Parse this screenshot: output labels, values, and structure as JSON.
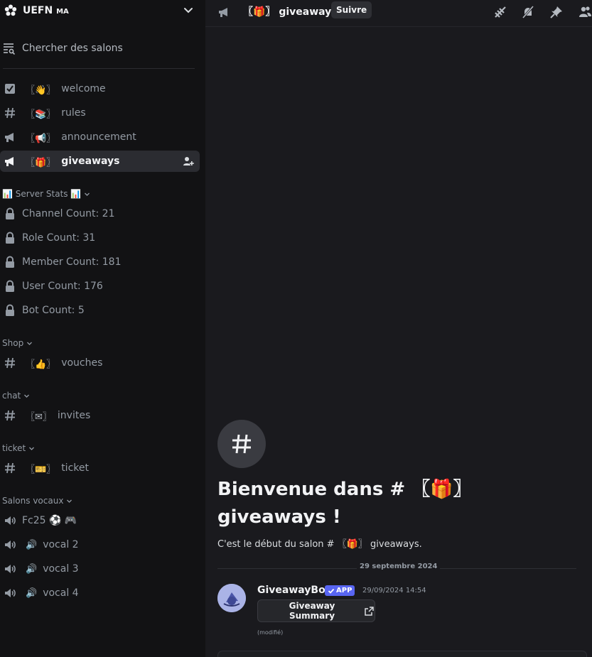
{
  "server": {
    "name": "UEFN",
    "tag": "MA",
    "logo_icon": "gear-flower-icon"
  },
  "sidebar": {
    "search_label": "Chercher des salons",
    "channels": [
      {
        "icon": "rules-checkbox-icon",
        "emoji": "〖👋〗",
        "name": "welcome"
      },
      {
        "icon": "hash-icon",
        "emoji": "〖📚〗",
        "name": "rules"
      },
      {
        "icon": "megaphone-icon",
        "emoji": "〖📢〗",
        "name": "announcement"
      },
      {
        "icon": "megaphone-icon",
        "emoji": "〖🎁〗",
        "name": "giveaways",
        "active": true
      }
    ],
    "categories": {
      "server_stats": "📊 Server Stats 📊",
      "shop": "Shop",
      "chat": "chat",
      "ticket": "ticket",
      "voice": "Salons vocaux"
    },
    "stats_channels": [
      "Channel Count: 21",
      "Role Count: 31",
      "Member Count: 181",
      "User Count: 176",
      "Bot Count: 5"
    ],
    "shop_channels": [
      {
        "emoji": "〖👍〗",
        "name": "vouches"
      }
    ],
    "chat_channels": [
      {
        "emoji": "〖✉〗",
        "name": "invites"
      }
    ],
    "ticket_channels": [
      {
        "emoji": "〖🎫〗",
        "name": "ticket"
      }
    ],
    "voice_channels": [
      {
        "name": "Fc25 ⚽ 🎮"
      },
      {
        "emoji": "🔊",
        "name": "vocal 2"
      },
      {
        "emoji": "🔊",
        "name": "vocal 3"
      },
      {
        "emoji": "🔊",
        "name": "vocal 4"
      }
    ]
  },
  "topbar": {
    "channel_emoji": "〖🎁〗",
    "channel_name": "giveaways",
    "follow_label": "Suivre",
    "icons": [
      "threads-icon",
      "mute-bell-icon",
      "pin-icon",
      "members-icon"
    ]
  },
  "main": {
    "welcome_title": "Bienvenue dans # 〖🎁〗 giveaways !",
    "welcome_sub": "C'est le début du salon # 〖🎁〗 giveaways.",
    "date_divider": "29 septembre 2024",
    "message": {
      "author": "GiveawayBot",
      "badge": "APP",
      "timestamp": "29/09/2024 14:54",
      "button_label": "Giveaway Summary",
      "edited": "(modifié)"
    }
  },
  "colors": {
    "sidebar_bg": "#121214",
    "main_bg": "#1a1a1e",
    "active_channel_bg": "#2b2c31",
    "app_badge": "#5865f2",
    "muted_text": "#949ba4"
  }
}
